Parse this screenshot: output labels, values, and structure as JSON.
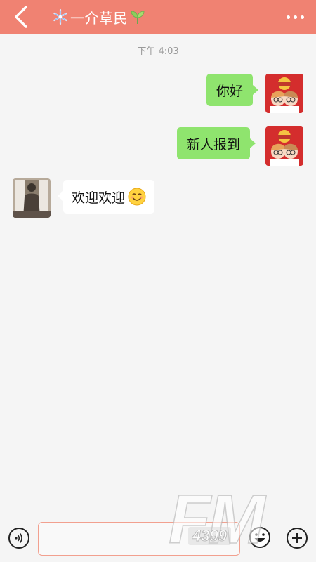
{
  "header": {
    "title": "一介草民",
    "background": "#f08272",
    "left_icon": "back-arrow-icon",
    "title_prefix_icon": "snowflake-icon",
    "title_suffix_icon": "sprout-icon",
    "right_icon": "more-dots-icon"
  },
  "timestamp": "下午 4:03",
  "messages": [
    {
      "sender": "me",
      "text": "你好",
      "bubble_color": "#8fe46e"
    },
    {
      "sender": "me",
      "text": "新人报到",
      "bubble_color": "#8fe46e"
    },
    {
      "sender": "other",
      "text": "欢迎欢迎",
      "emoji": "smiling-face-emoji",
      "bubble_color": "#ffffff"
    }
  ],
  "input_bar": {
    "voice_icon": "voice-icon",
    "input_value": "",
    "input_placeholder": "",
    "emoji_icon": "emoji-face-icon",
    "plus_icon": "plus-icon",
    "input_border": "#f2a08f"
  },
  "watermark": {
    "logo_text": "FM",
    "number": "4399"
  }
}
